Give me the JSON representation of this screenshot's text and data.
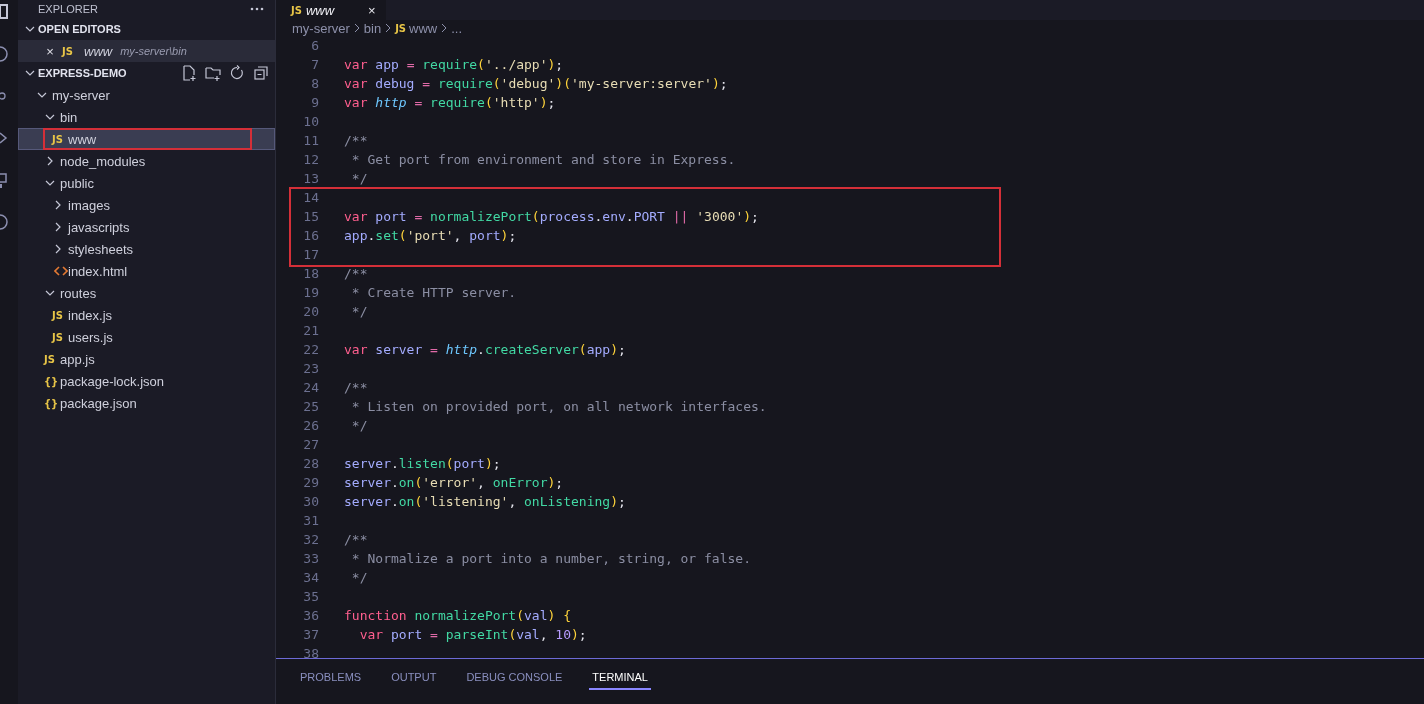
{
  "sidebar": {
    "title": "EXPLORER",
    "open_editors": {
      "label": "OPEN EDITORS",
      "expanded": true,
      "items": [
        {
          "close": "×",
          "badge": "JS",
          "kind": "js",
          "name": "www",
          "path": "my-server\\bin"
        }
      ]
    },
    "workspace": {
      "label": "EXPRESS-DEMO",
      "expanded": true,
      "tree": [
        {
          "name": "my-server",
          "kind": "folder",
          "expanded": true,
          "selected": false,
          "children": [
            {
              "name": "bin",
              "kind": "folder",
              "expanded": true,
              "selected": false,
              "children": [
                {
                  "name": "www",
                  "kind": "js",
                  "badge": "JS",
                  "selected": true,
                  "annotated": true
                }
              ]
            },
            {
              "name": "node_modules",
              "kind": "folder",
              "expanded": false,
              "selected": false
            },
            {
              "name": "public",
              "kind": "folder",
              "expanded": true,
              "selected": false,
              "children": [
                {
                  "name": "images",
                  "kind": "folder",
                  "expanded": false,
                  "selected": false
                },
                {
                  "name": "javascripts",
                  "kind": "folder",
                  "expanded": false,
                  "selected": false
                },
                {
                  "name": "stylesheets",
                  "kind": "folder",
                  "expanded": false,
                  "selected": false
                },
                {
                  "name": "index.html",
                  "kind": "html",
                  "selected": false
                }
              ]
            },
            {
              "name": "routes",
              "kind": "folder",
              "expanded": true,
              "selected": false,
              "children": [
                {
                  "name": "index.js",
                  "kind": "js",
                  "badge": "JS",
                  "selected": false
                },
                {
                  "name": "users.js",
                  "kind": "js",
                  "badge": "JS",
                  "selected": false
                }
              ]
            },
            {
              "name": "app.js",
              "kind": "js",
              "badge": "JS",
              "selected": false
            },
            {
              "name": "package-lock.json",
              "kind": "json",
              "badge": "{}",
              "selected": false
            },
            {
              "name": "package.json",
              "kind": "json",
              "badge": "{}",
              "selected": false
            }
          ]
        }
      ]
    }
  },
  "editor": {
    "tab": {
      "badge": "JS",
      "title": "www",
      "close": "×"
    },
    "breadcrumb": [
      {
        "text": "my-server"
      },
      {
        "text": "bin"
      },
      {
        "text": "www",
        "badge": "JS"
      },
      {
        "text": "..."
      }
    ],
    "lines": [
      {
        "number": "6"
      },
      {
        "number": "7",
        "tokens": [
          {
            "text": "var ",
            "kind": "kw"
          },
          {
            "text": "app ",
            "kind": "id"
          },
          {
            "text": "= ",
            "kind": "op"
          },
          {
            "text": "require",
            "kind": "fn"
          },
          {
            "text": "(",
            "kind": "paren"
          },
          {
            "text": "'../app'",
            "kind": "str"
          },
          {
            "text": ")",
            "kind": "paren"
          },
          {
            "text": ";",
            "kind": "punc"
          }
        ]
      },
      {
        "number": "8",
        "tokens": [
          {
            "text": "var ",
            "kind": "kw"
          },
          {
            "text": "debug ",
            "kind": "id"
          },
          {
            "text": "= ",
            "kind": "op"
          },
          {
            "text": "require",
            "kind": "fn"
          },
          {
            "text": "(",
            "kind": "paren"
          },
          {
            "text": "'debug'",
            "kind": "str"
          },
          {
            "text": ")(",
            "kind": "paren"
          },
          {
            "text": "'my-server:server'",
            "kind": "str"
          },
          {
            "text": ")",
            "kind": "paren"
          },
          {
            "text": ";",
            "kind": "punc"
          }
        ]
      },
      {
        "number": "9",
        "tokens": [
          {
            "text": "var ",
            "kind": "kw"
          },
          {
            "text": "http",
            "kind": "builtin"
          },
          {
            "text": " = ",
            "kind": "op"
          },
          {
            "text": "require",
            "kind": "fn"
          },
          {
            "text": "(",
            "kind": "paren"
          },
          {
            "text": "'http'",
            "kind": "str"
          },
          {
            "text": ")",
            "kind": "paren"
          },
          {
            "text": ";",
            "kind": "punc"
          }
        ]
      },
      {
        "number": "10"
      },
      {
        "number": "11",
        "tokens": [
          {
            "text": "/**",
            "kind": "comment"
          }
        ]
      },
      {
        "number": "12",
        "tokens": [
          {
            "text": " * Get port from environment and store in Express.",
            "kind": "comment"
          }
        ]
      },
      {
        "number": "13",
        "tokens": [
          {
            "text": " */",
            "kind": "comment"
          }
        ]
      },
      {
        "number": "14",
        "annotated": true
      },
      {
        "number": "15",
        "annotated": true,
        "tokens": [
          {
            "text": "var ",
            "kind": "kw"
          },
          {
            "text": "port ",
            "kind": "id"
          },
          {
            "text": "= ",
            "kind": "op"
          },
          {
            "text": "normalizePort",
            "kind": "fn"
          },
          {
            "text": "(",
            "kind": "paren"
          },
          {
            "text": "process",
            "kind": "id"
          },
          {
            "text": ".",
            "kind": "punc"
          },
          {
            "text": "env",
            "kind": "id"
          },
          {
            "text": ".",
            "kind": "punc"
          },
          {
            "text": "PORT ",
            "kind": "id"
          },
          {
            "text": "|| ",
            "kind": "op"
          },
          {
            "text": "'3000'",
            "kind": "str"
          },
          {
            "text": ")",
            "kind": "paren"
          },
          {
            "text": ";",
            "kind": "punc"
          }
        ]
      },
      {
        "number": "16",
        "annotated": true,
        "tokens": [
          {
            "text": "app",
            "kind": "id"
          },
          {
            "text": ".",
            "kind": "punc"
          },
          {
            "text": "set",
            "kind": "fn"
          },
          {
            "text": "(",
            "kind": "paren"
          },
          {
            "text": "'port'",
            "kind": "str"
          },
          {
            "text": ", ",
            "kind": "punc"
          },
          {
            "text": "port",
            "kind": "id"
          },
          {
            "text": ")",
            "kind": "paren"
          },
          {
            "text": ";",
            "kind": "punc"
          }
        ]
      },
      {
        "number": "17",
        "annotated": true
      },
      {
        "number": "18",
        "tokens": [
          {
            "text": "/**",
            "kind": "comment"
          }
        ]
      },
      {
        "number": "19",
        "tokens": [
          {
            "text": " * Create HTTP server.",
            "kind": "comment"
          }
        ]
      },
      {
        "number": "20",
        "tokens": [
          {
            "text": " */",
            "kind": "comment"
          }
        ]
      },
      {
        "number": "21"
      },
      {
        "number": "22",
        "tokens": [
          {
            "text": "var ",
            "kind": "kw"
          },
          {
            "text": "server ",
            "kind": "id"
          },
          {
            "text": "= ",
            "kind": "op"
          },
          {
            "text": "http",
            "kind": "builtin"
          },
          {
            "text": ".",
            "kind": "punc"
          },
          {
            "text": "createServer",
            "kind": "fn"
          },
          {
            "text": "(",
            "kind": "paren"
          },
          {
            "text": "app",
            "kind": "id"
          },
          {
            "text": ")",
            "kind": "paren"
          },
          {
            "text": ";",
            "kind": "punc"
          }
        ]
      },
      {
        "number": "23"
      },
      {
        "number": "24",
        "tokens": [
          {
            "text": "/**",
            "kind": "comment"
          }
        ]
      },
      {
        "number": "25",
        "tokens": [
          {
            "text": " * Listen on provided port, on all network interfaces.",
            "kind": "comment"
          }
        ]
      },
      {
        "number": "26",
        "tokens": [
          {
            "text": " */",
            "kind": "comment"
          }
        ]
      },
      {
        "number": "27"
      },
      {
        "number": "28",
        "tokens": [
          {
            "text": "server",
            "kind": "id"
          },
          {
            "text": ".",
            "kind": "punc"
          },
          {
            "text": "listen",
            "kind": "fn"
          },
          {
            "text": "(",
            "kind": "paren"
          },
          {
            "text": "port",
            "kind": "id"
          },
          {
            "text": ")",
            "kind": "paren"
          },
          {
            "text": ";",
            "kind": "punc"
          }
        ]
      },
      {
        "number": "29",
        "tokens": [
          {
            "text": "server",
            "kind": "id"
          },
          {
            "text": ".",
            "kind": "punc"
          },
          {
            "text": "on",
            "kind": "fn"
          },
          {
            "text": "(",
            "kind": "paren"
          },
          {
            "text": "'error'",
            "kind": "str"
          },
          {
            "text": ", ",
            "kind": "punc"
          },
          {
            "text": "onError",
            "kind": "fn"
          },
          {
            "text": ")",
            "kind": "paren"
          },
          {
            "text": ";",
            "kind": "punc"
          }
        ]
      },
      {
        "number": "30",
        "tokens": [
          {
            "text": "server",
            "kind": "id"
          },
          {
            "text": ".",
            "kind": "punc"
          },
          {
            "text": "on",
            "kind": "fn"
          },
          {
            "text": "(",
            "kind": "paren"
          },
          {
            "text": "'listening'",
            "kind": "str"
          },
          {
            "text": ", ",
            "kind": "punc"
          },
          {
            "text": "onListening",
            "kind": "fn"
          },
          {
            "text": ")",
            "kind": "paren"
          },
          {
            "text": ";",
            "kind": "punc"
          }
        ]
      },
      {
        "number": "31"
      },
      {
        "number": "32",
        "tokens": [
          {
            "text": "/**",
            "kind": "comment"
          }
        ]
      },
      {
        "number": "33",
        "tokens": [
          {
            "text": " * Normalize a port into a number, string, or false.",
            "kind": "comment"
          }
        ]
      },
      {
        "number": "34",
        "tokens": [
          {
            "text": " */",
            "kind": "comment"
          }
        ]
      },
      {
        "number": "35"
      },
      {
        "number": "36",
        "tokens": [
          {
            "text": "function ",
            "kind": "kw"
          },
          {
            "text": "normalizePort",
            "kind": "fn"
          },
          {
            "text": "(",
            "kind": "paren"
          },
          {
            "text": "val",
            "kind": "id"
          },
          {
            "text": ") {",
            "kind": "paren"
          }
        ]
      },
      {
        "number": "37",
        "indent": true,
        "tokens": [
          {
            "text": "var ",
            "kind": "kw"
          },
          {
            "text": "port ",
            "kind": "id"
          },
          {
            "text": "= ",
            "kind": "op"
          },
          {
            "text": "parseInt",
            "kind": "fn"
          },
          {
            "text": "(",
            "kind": "paren"
          },
          {
            "text": "val",
            "kind": "id"
          },
          {
            "text": ", ",
            "kind": "punc"
          },
          {
            "text": "10",
            "kind": "num"
          },
          {
            "text": ")",
            "kind": "paren"
          },
          {
            "text": ";",
            "kind": "punc"
          }
        ]
      },
      {
        "number": "38"
      }
    ]
  },
  "panel": {
    "tabs": [
      {
        "label": "PROBLEMS",
        "selected": false
      },
      {
        "label": "OUTPUT",
        "selected": false
      },
      {
        "label": "DEBUG CONSOLE",
        "selected": false
      },
      {
        "label": "TERMINAL",
        "selected": true
      }
    ]
  }
}
